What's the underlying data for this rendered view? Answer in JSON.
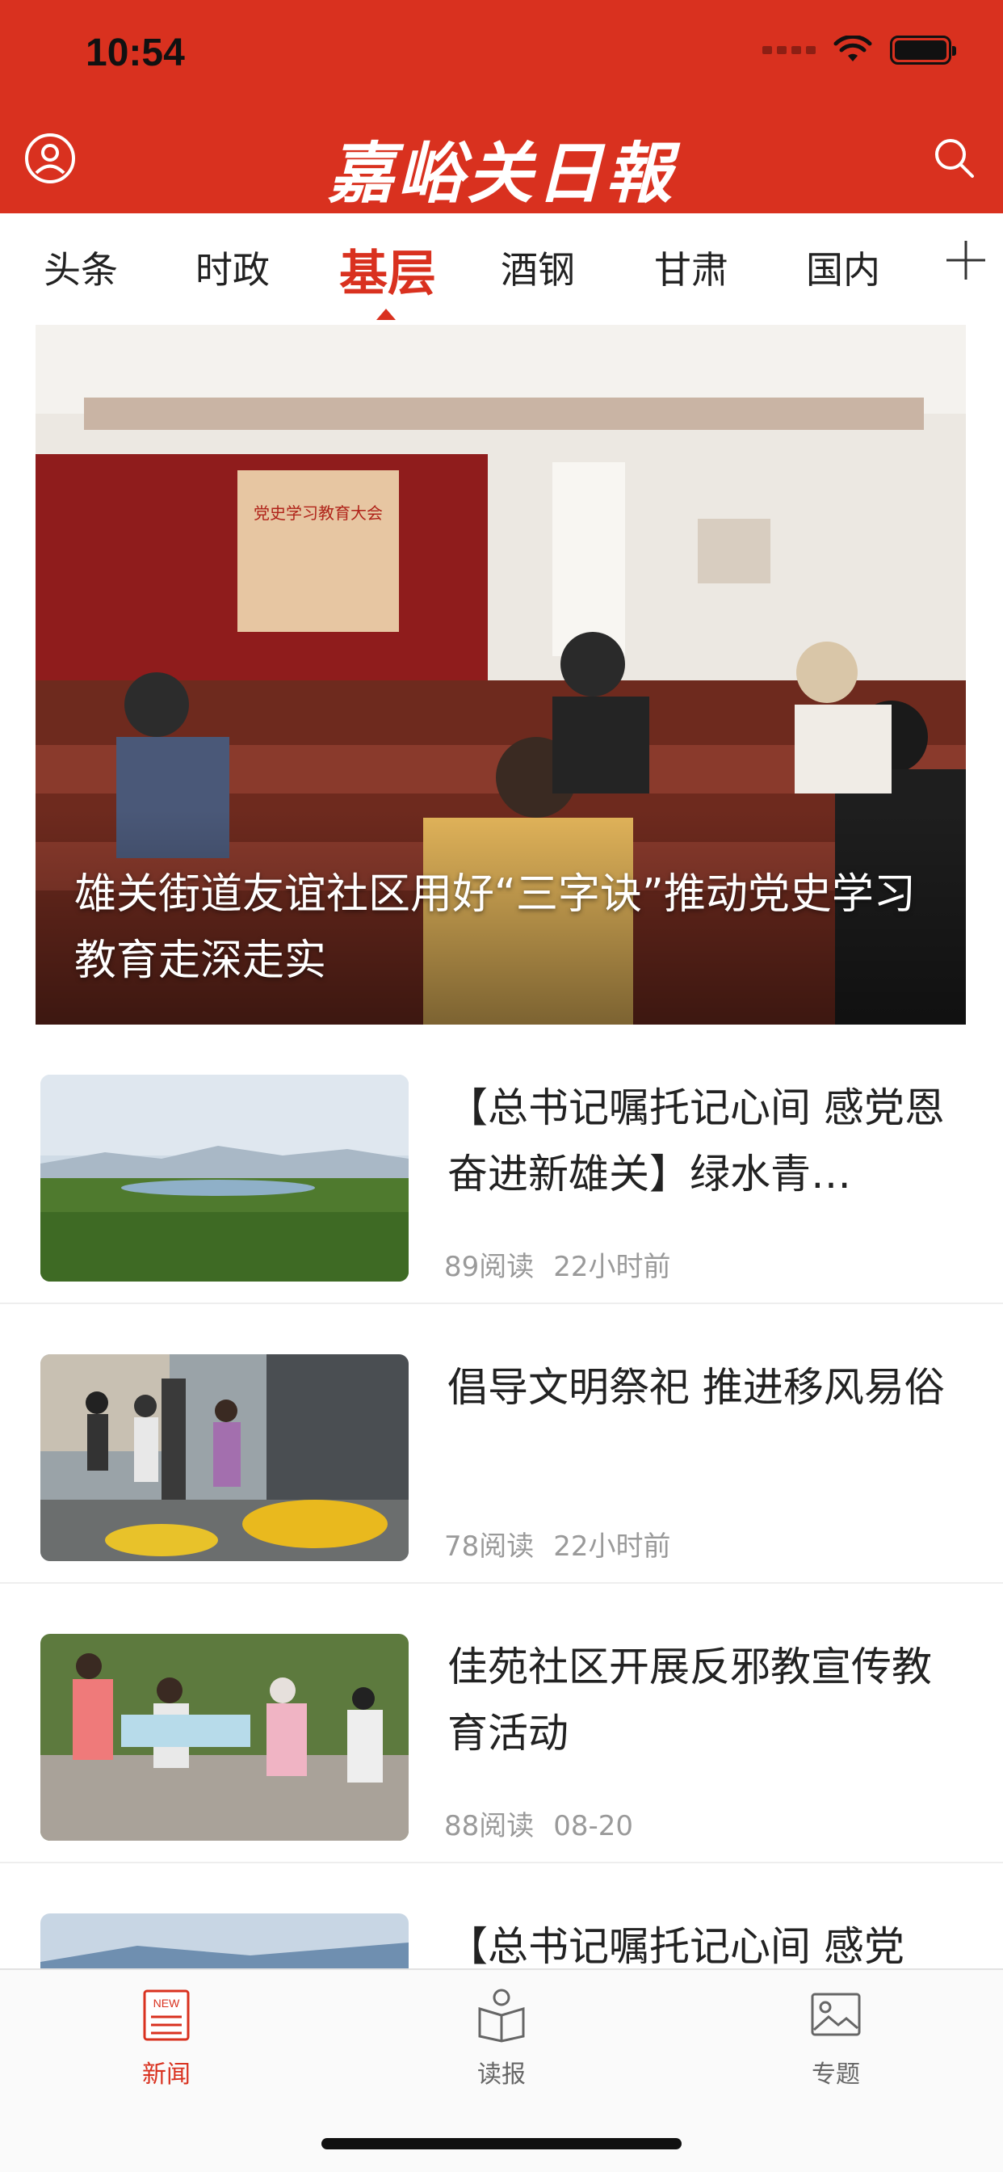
{
  "status": {
    "time": "10:54"
  },
  "header": {
    "brand": "嘉峪关日報"
  },
  "tabs": [
    {
      "label": "头条"
    },
    {
      "label": "时政"
    },
    {
      "label": "基层"
    },
    {
      "label": "酒钢"
    },
    {
      "label": "甘肃"
    },
    {
      "label": "国内"
    }
  ],
  "active_tab": "基层",
  "hero": {
    "title": "雄关街道友谊社区用好“三字诀”推动党史学习教育走深走实",
    "banner_text": "党史学习教育大会"
  },
  "articles": [
    {
      "title": "【总书记嘱托记心间 感党恩奋进新雄关】绿水青…",
      "reads": "89阅读",
      "time": "22小时前"
    },
    {
      "title": "倡导文明祭祀 推进移风易俗",
      "reads": "78阅读",
      "time": "22小时前"
    },
    {
      "title": "佳苑社区开展反邪教宣传教育活动",
      "reads": "88阅读",
      "time": "08-20"
    },
    {
      "title": "【总书记嘱托记心间 感党",
      "reads": "",
      "time": ""
    }
  ],
  "bottom_nav": [
    {
      "label": "新闻",
      "icon": "news-icon",
      "active": true
    },
    {
      "label": "读报",
      "icon": "newspaper-reader-icon",
      "active": false
    },
    {
      "label": "专题",
      "icon": "image-icon",
      "active": false
    }
  ],
  "news_icon_text": "NEW",
  "colors": {
    "brand_red": "#d9311f",
    "meta_gray": "#9a9a9a"
  }
}
